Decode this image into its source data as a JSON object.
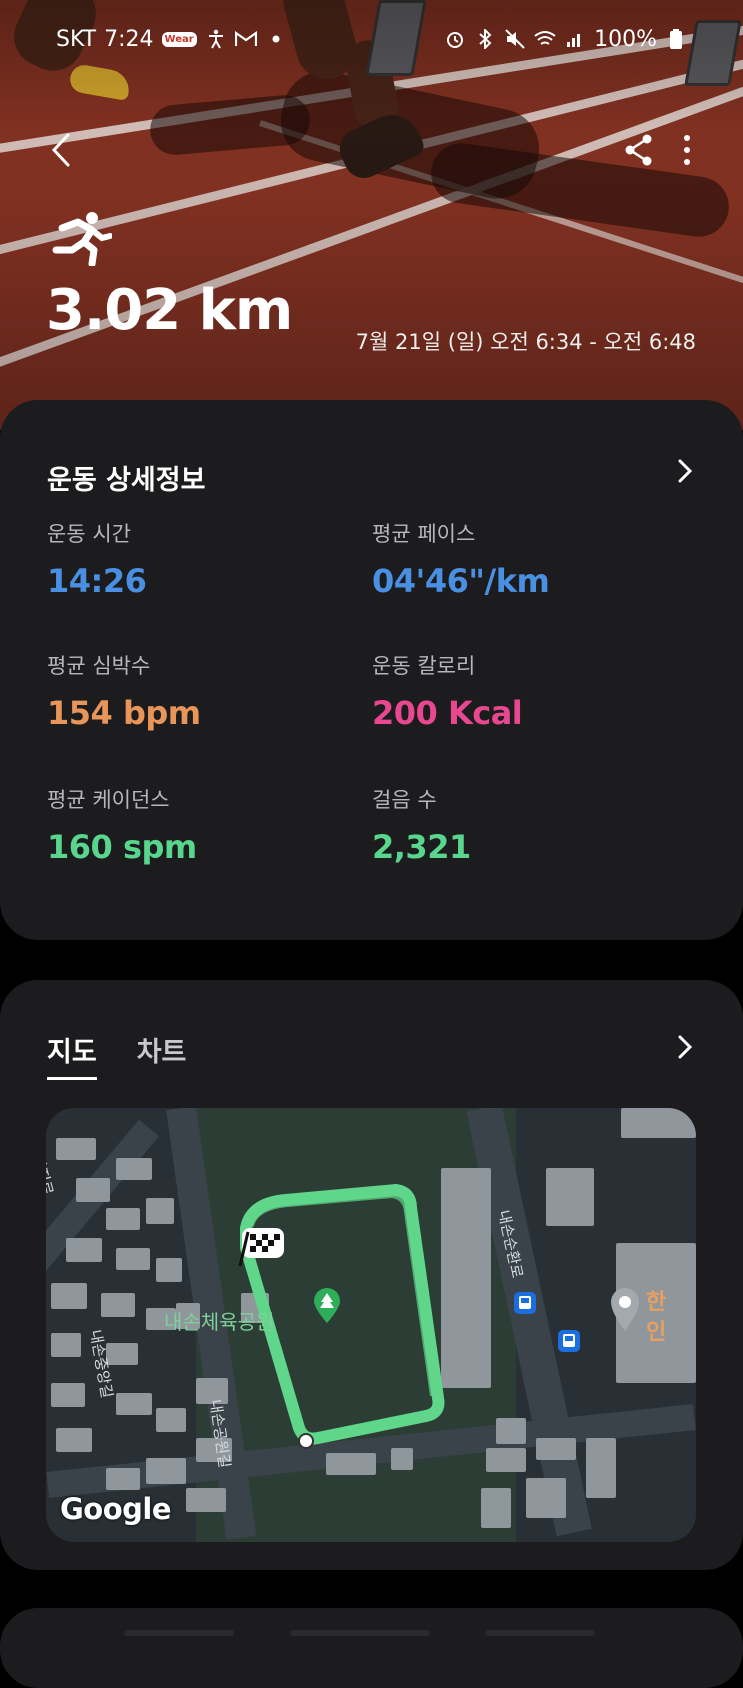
{
  "status_bar": {
    "carrier": "SKT",
    "time": "7:24",
    "wear_badge": "Wear",
    "battery": "100%"
  },
  "header": {
    "distance": "3.02 km",
    "date_range": "7월 21일 (일) 오전 6:34 - 오전 6:48"
  },
  "details": {
    "title": "운동 상세정보",
    "stats": [
      {
        "label": "운동 시간",
        "value": "14:26",
        "color": "#4a90e2"
      },
      {
        "label": "평균 페이스",
        "value": "04'46\"/km",
        "color": "#4a90e2"
      },
      {
        "label": "평균 심박수",
        "value": "154 bpm",
        "color": "#e8955a"
      },
      {
        "label": "운동 칼로리",
        "value": "200 Kcal",
        "color": "#e8488f"
      },
      {
        "label": "평균 케이던스",
        "value": "160 spm",
        "color": "#58d68d"
      },
      {
        "label": "걸음 수",
        "value": "2,321",
        "color": "#58d68d"
      }
    ]
  },
  "map_card": {
    "tabs": [
      {
        "label": "지도",
        "active": true
      },
      {
        "label": "차트",
        "active": false
      }
    ],
    "park_label": "내손체육공원",
    "road_labels": [
      "복지로",
      "내손순환로",
      "내손중앙길",
      "내손공원길"
    ],
    "edge_labels": [
      "한",
      "인"
    ],
    "google": "Google",
    "route_color": "#5fd68a"
  }
}
